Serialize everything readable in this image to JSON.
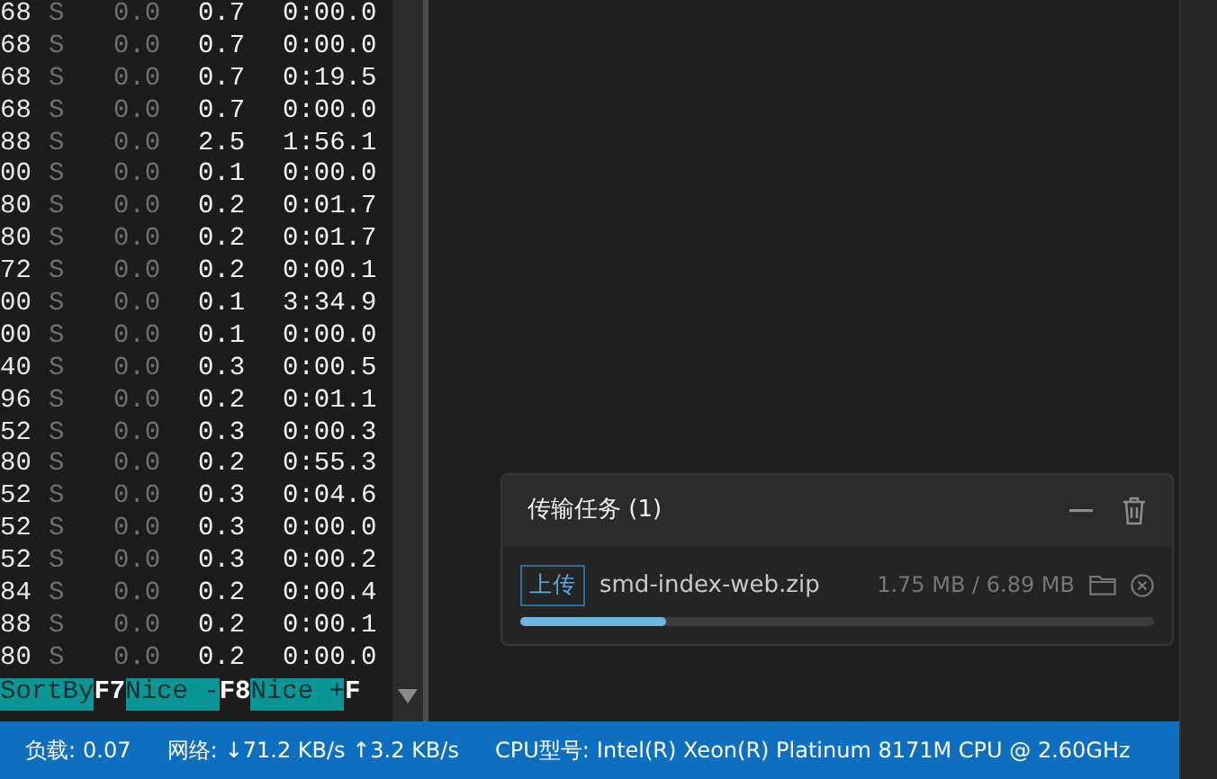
{
  "terminal": {
    "rows": [
      {
        "column_1": "68",
        "column_2": "S",
        "column_3": "0.0",
        "column_4": "0.7",
        "column_5": "0:00.0"
      },
      {
        "column_1": "68",
        "column_2": "S",
        "column_3": "0.0",
        "column_4": "0.7",
        "column_5": "0:00.0"
      },
      {
        "column_1": "68",
        "column_2": "S",
        "column_3": "0.0",
        "column_4": "0.7",
        "column_5": "0:19.5"
      },
      {
        "column_1": "68",
        "column_2": "S",
        "column_3": "0.0",
        "column_4": "0.7",
        "column_5": "0:00.0"
      },
      {
        "column_1": "88",
        "column_2": "S",
        "column_3": "0.0",
        "column_4": "2.5",
        "column_5": "1:56.1"
      },
      {
        "column_1": "00",
        "column_2": "S",
        "column_3": "0.0",
        "column_4": "0.1",
        "column_5": "0:00.0"
      },
      {
        "column_1": "80",
        "column_2": "S",
        "column_3": "0.0",
        "column_4": "0.2",
        "column_5": "0:01.7"
      },
      {
        "column_1": "80",
        "column_2": "S",
        "column_3": "0.0",
        "column_4": "0.2",
        "column_5": "0:01.7"
      },
      {
        "column_1": "72",
        "column_2": "S",
        "column_3": "0.0",
        "column_4": "0.2",
        "column_5": "0:00.1"
      },
      {
        "column_1": "00",
        "column_2": "S",
        "column_3": "0.0",
        "column_4": "0.1",
        "column_5": "3:34.9"
      },
      {
        "column_1": "00",
        "column_2": "S",
        "column_3": "0.0",
        "column_4": "0.1",
        "column_5": "0:00.0"
      },
      {
        "column_1": "40",
        "column_2": "S",
        "column_3": "0.0",
        "column_4": "0.3",
        "column_5": "0:00.5"
      },
      {
        "column_1": "96",
        "column_2": "S",
        "column_3": "0.0",
        "column_4": "0.2",
        "column_5": "0:01.1"
      },
      {
        "column_1": "52",
        "column_2": "S",
        "column_3": "0.0",
        "column_4": "0.3",
        "column_5": "0:00.3"
      },
      {
        "column_1": "80",
        "column_2": "S",
        "column_3": "0.0",
        "column_4": "0.2",
        "column_5": "0:55.3"
      },
      {
        "column_1": "52",
        "column_2": "S",
        "column_3": "0.0",
        "column_4": "0.3",
        "column_5": "0:04.6"
      },
      {
        "column_1": "52",
        "column_2": "S",
        "column_3": "0.0",
        "column_4": "0.3",
        "column_5": "0:00.0"
      },
      {
        "column_1": "52",
        "column_2": "S",
        "column_3": "0.0",
        "column_4": "0.3",
        "column_5": "0:00.2"
      },
      {
        "column_1": "84",
        "column_2": "S",
        "column_3": "0.0",
        "column_4": "0.2",
        "column_5": "0:00.4"
      },
      {
        "column_1": "88",
        "column_2": "S",
        "column_3": "0.0",
        "column_4": "0.2",
        "column_5": "0:00.1"
      },
      {
        "column_1": "80",
        "column_2": "S",
        "column_3": "0.0",
        "column_4": "0.2",
        "column_5": "0:00.0"
      }
    ],
    "function_keys": [
      {
        "kind": "label",
        "text": "SortBy"
      },
      {
        "kind": "key",
        "text": "F7"
      },
      {
        "kind": "label",
        "text": "Nice -"
      },
      {
        "kind": "key",
        "text": "F8"
      },
      {
        "kind": "label",
        "text": "Nice +"
      },
      {
        "kind": "key",
        "text": "F"
      }
    ]
  },
  "transfer_panel": {
    "title": "传输任务 (1)",
    "tasks": [
      {
        "direction": "上传",
        "filename": "smd-index-web.zip",
        "size": "1.75 MB / 6.89 MB",
        "level": 0.23
      }
    ]
  },
  "status_bar": {
    "items": [
      {
        "label": "负载:",
        "value": "0.07"
      },
      {
        "label": "网络:",
        "value": "↓71.2 KB/s ↑3.2 KB/s"
      },
      {
        "label": "CPU型号:",
        "value": "Intel(R) Xeon(R) Platinum 8171M CPU @ 2.60GHz"
      }
    ]
  }
}
